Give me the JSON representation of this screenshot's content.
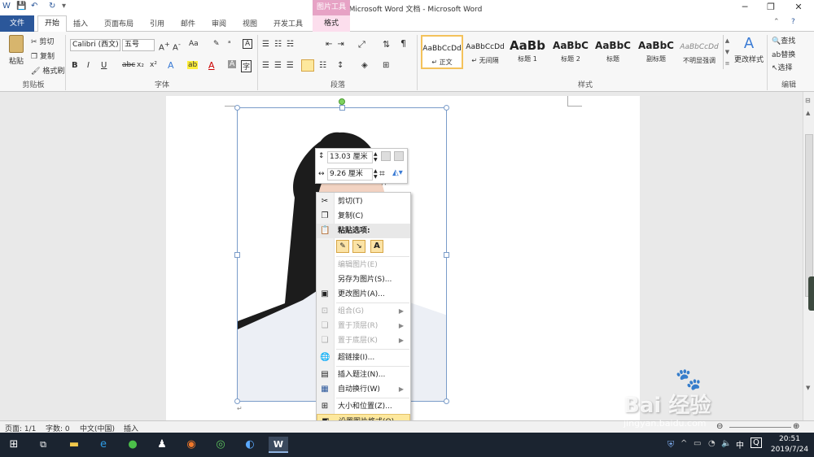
{
  "window": {
    "title": "新建 Microsoft Word 文档  -  Microsoft Word",
    "context_tab_group": "图片工具"
  },
  "tabs": [
    "文件",
    "开始",
    "插入",
    "页面布局",
    "引用",
    "邮件",
    "审阅",
    "视图",
    "开发工具",
    "格式"
  ],
  "ribbon": {
    "clipboard": {
      "paste": "粘贴",
      "cut": "剪切",
      "copy": "复制",
      "format_painter": "格式刷",
      "group": "剪贴板"
    },
    "font": {
      "name": "Calibri (西文)",
      "size": "五号",
      "group": "字体",
      "clear": "Aa"
    },
    "paragraph": {
      "group": "段落"
    },
    "styles": {
      "group": "样式",
      "items": [
        {
          "preview": "AaBbCcDd",
          "name": "↵ 正文"
        },
        {
          "preview": "AaBbCcDd",
          "name": "↵ 无间隔"
        },
        {
          "preview": "AaBb",
          "name": "标题 1"
        },
        {
          "preview": "AaBbC",
          "name": "标题 2"
        },
        {
          "preview": "AaBbC",
          "name": "标题"
        },
        {
          "preview": "AaBbC",
          "name": "副标题"
        },
        {
          "preview": "AaBbCcDd",
          "name": "不明显强调"
        }
      ],
      "change": "更改样式"
    },
    "editing": {
      "find": "查找",
      "replace": "替换",
      "select": "选择",
      "group": "编辑"
    }
  },
  "size_panel": {
    "height": "13.03 厘米",
    "width": "9.26 厘米"
  },
  "context_menu": {
    "cut": "剪切(T)",
    "copy": "复制(C)",
    "paste_options": "粘贴选项:",
    "edit_picture": "编辑图片(E)",
    "save_as_picture": "另存为图片(S)...",
    "change_picture": "更改图片(A)...",
    "group": "组合(G)",
    "bring_to_front": "置于顶层(R)",
    "send_to_back": "置于底层(K)",
    "hyperlink": "超链接(I)...",
    "insert_caption": "插入题注(N)...",
    "wrap_text": "自动换行(W)",
    "size_position": "大小和位置(Z)...",
    "format_picture": "设置图片格式(O)..."
  },
  "status": {
    "page": "页面: 1/1",
    "words": "字数: 0",
    "language": "中文(中国)",
    "mode": "插入"
  },
  "taskbar": {
    "time": "20:51",
    "date": "2019/7/24",
    "ime": "中"
  },
  "watermark": {
    "brand": "Bai 经验",
    "url": "jingyan.baidu.com"
  },
  "colors": {
    "accent": "#2b579a",
    "context_tab": "#e7a2c5",
    "highlight": "#fde89d"
  }
}
